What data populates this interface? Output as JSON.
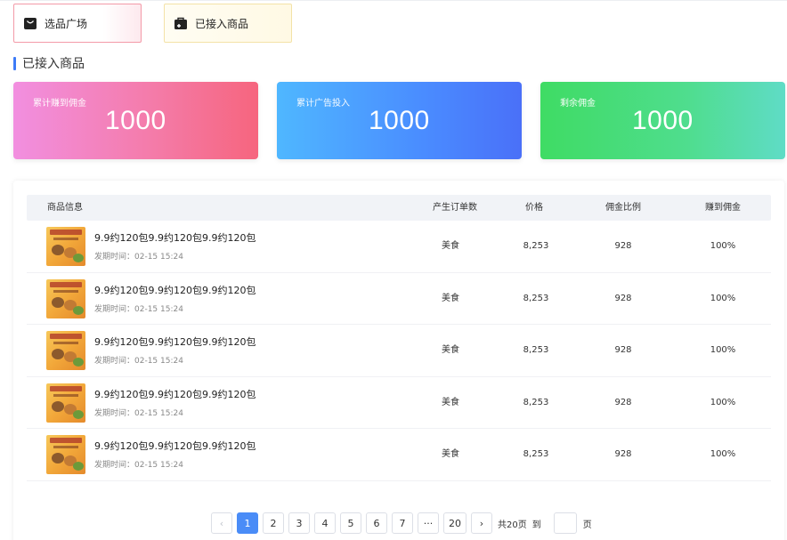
{
  "tabs": [
    {
      "label": "选品广场",
      "icon": "shopping-bag-icon"
    },
    {
      "label": "已接入商品",
      "icon": "briefcase-plus-icon"
    }
  ],
  "section_title": "已接入商品",
  "stats": [
    {
      "label": "累计赚到佣金",
      "value": "1000"
    },
    {
      "label": "累计广告投入",
      "value": "1000"
    },
    {
      "label": "剩余佣金",
      "value": "1000"
    }
  ],
  "table": {
    "headers": [
      "商品信息",
      "产生订单数",
      "价格",
      "佣金比例",
      "赚到佣金"
    ],
    "rows": [
      {
        "name": "9.9约120包9.9约120包9.9约120包",
        "time": "发期时间：02-15 15:24",
        "orders": "美食",
        "price": "8,253",
        "rate": "928",
        "earned": "100%"
      },
      {
        "name": "9.9约120包9.9约120包9.9约120包",
        "time": "发期时间：02-15 15:24",
        "orders": "美食",
        "price": "8,253",
        "rate": "928",
        "earned": "100%"
      },
      {
        "name": "9.9约120包9.9约120包9.9约120包",
        "time": "发期时间：02-15 15:24",
        "orders": "美食",
        "price": "8,253",
        "rate": "928",
        "earned": "100%"
      },
      {
        "name": "9.9约120包9.9约120包9.9约120包",
        "time": "发期时间：02-15 15:24",
        "orders": "美食",
        "price": "8,253",
        "rate": "928",
        "earned": "100%"
      },
      {
        "name": "9.9约120包9.9约120包9.9约120包",
        "time": "发期时间：02-15 15:24",
        "orders": "美食",
        "price": "8,253",
        "rate": "928",
        "earned": "100%"
      }
    ]
  },
  "pagination": {
    "prev": "‹",
    "pages": [
      "1",
      "2",
      "3",
      "4",
      "5",
      "6",
      "7",
      "···",
      "20"
    ],
    "next": "›",
    "total": "共20页",
    "goto_label": "到",
    "page_suffix": "页",
    "active_page": "1"
  }
}
